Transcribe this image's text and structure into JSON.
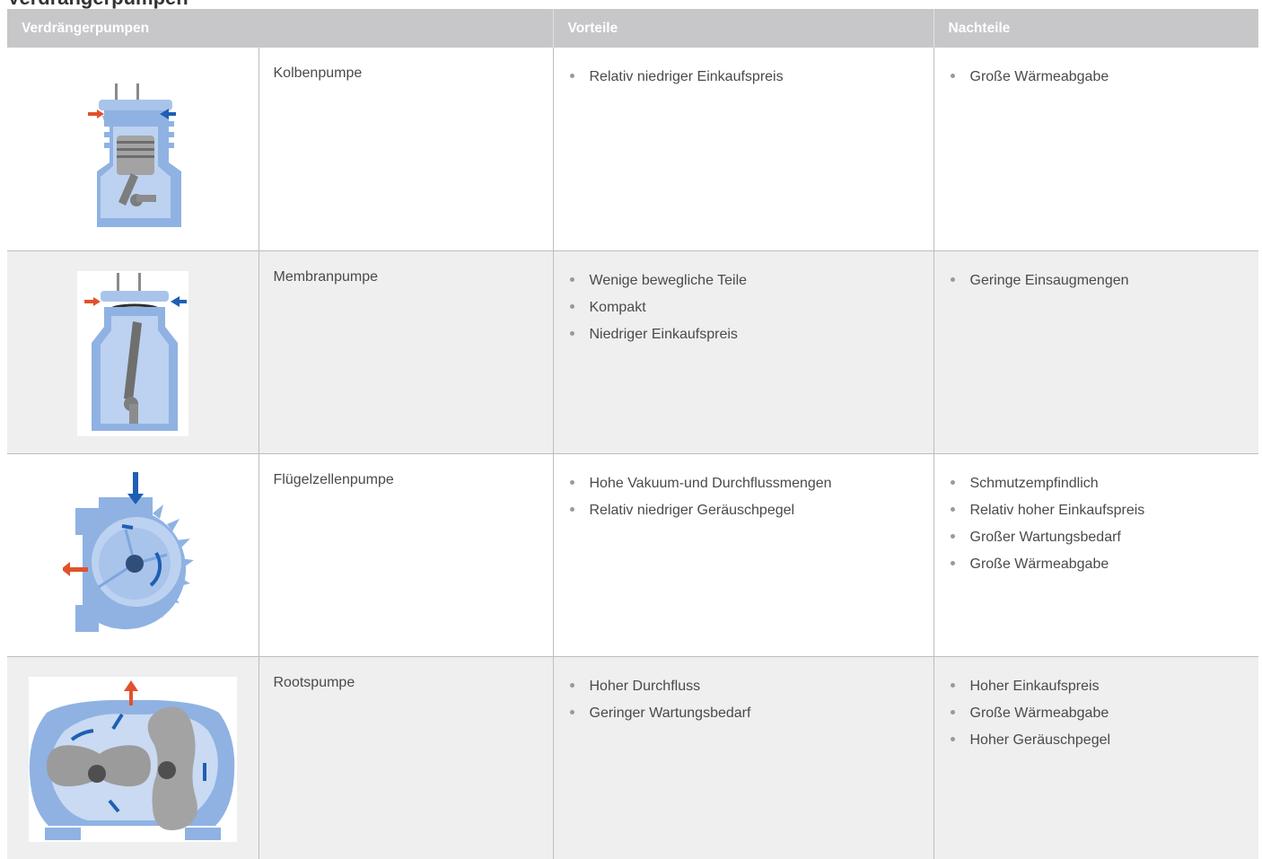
{
  "page": {
    "heading": "Verdrängerpumpen"
  },
  "table": {
    "headers": [
      "Verdrängerpumpen",
      "Vorteile",
      "Nachteile"
    ],
    "rows": [
      {
        "name": "Kolbenpumpe",
        "image_icon": "piston-pump-illustration",
        "pros": [
          "Relativ niedriger Einkaufspreis"
        ],
        "cons": [
          "Große Wärmeabgabe"
        ]
      },
      {
        "name": "Membranpumpe",
        "image_icon": "diaphragm-pump-illustration",
        "pros": [
          "Wenige bewegliche Teile",
          "Kompakt",
          "Niedriger Einkaufspreis"
        ],
        "cons": [
          "Geringe Einsaugmengen"
        ]
      },
      {
        "name": "Flügelzellenpumpe",
        "image_icon": "rotary-vane-pump-illustration",
        "pros": [
          "Hohe Vakuum-und Durchflussmengen",
          "Relativ niedriger Geräuschpegel"
        ],
        "cons": [
          "Schmutzempfindlich",
          "Relativ hoher Einkaufspreis",
          "Großer Wartungsbedarf",
          "Große Wärmeabgabe"
        ]
      },
      {
        "name": "Rootspumpe",
        "image_icon": "roots-pump-illustration",
        "pros": [
          "Hoher Durchfluss",
          "Geringer Wartungsbedarf"
        ],
        "cons": [
          "Hoher Einkaufspreis",
          "Große Wärmeabgabe",
          "Hoher Geräuschpegel"
        ]
      }
    ]
  },
  "colors": {
    "header_bg": "#c7c7c9",
    "row_shade": "#efefef",
    "pump_blue": "#7ea6de",
    "arrow_out": "#e2512c",
    "arrow_in": "#1f5fb3"
  }
}
